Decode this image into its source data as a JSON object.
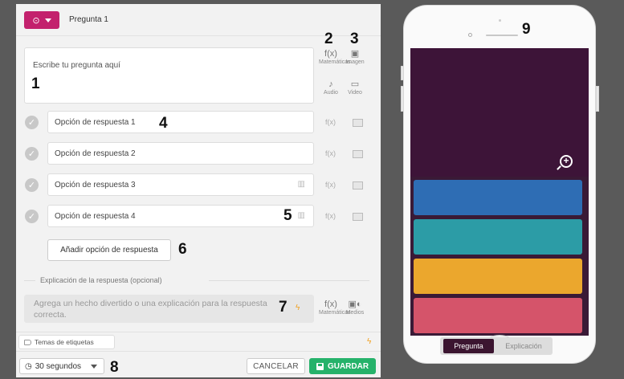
{
  "editor": {
    "question_type_icon": "clock-circle-icon",
    "question_title": "Pregunta 1",
    "question_placeholder": "Escribe tu pregunta aquí",
    "tools": {
      "math_label": "Matemáticas",
      "image_label": "Imagen",
      "audio_label": "Audio",
      "video_label": "Video",
      "media_label": "Medios"
    },
    "answers": [
      {
        "placeholder": "Opción de respuesta 1",
        "deletable": false
      },
      {
        "placeholder": "Opción de respuesta 2",
        "deletable": false
      },
      {
        "placeholder": "Opción de respuesta 3",
        "deletable": true
      },
      {
        "placeholder": "Opción de respuesta 4",
        "deletable": true
      }
    ],
    "add_answer_label": "Añadir opción de respuesta",
    "explanation_legend": "Explicación de la respuesta (opcional)",
    "explanation_placeholder": "Agrega un hecho divertido o una explicación para la respuesta correcta.",
    "tags_label": "Temas de etiquetas",
    "time_label": "30 segundos",
    "cancel_label": "CANCELAR",
    "save_label": "GUARDAR"
  },
  "callouts": [
    "1",
    "2",
    "3",
    "4",
    "5",
    "6",
    "7",
    "8",
    "9"
  ],
  "preview": {
    "tab_question": "Pregunta",
    "tab_explanation": "Explicación",
    "answer_colors": [
      "#2e6db4",
      "#2c9ca6",
      "#eba72d",
      "#d5546a"
    ]
  },
  "colors": {
    "accent": "#c3216d",
    "save": "#25b26a",
    "preview_bg": "#3d1438"
  }
}
